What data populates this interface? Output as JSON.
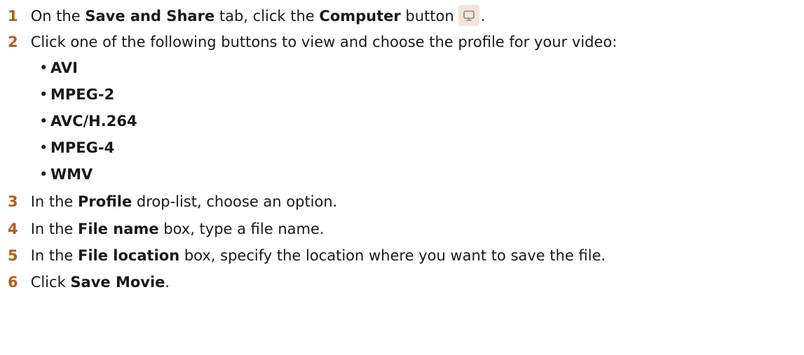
{
  "steps": [
    {
      "num": "1",
      "pre": "On the ",
      "b1": "Save and Share",
      "mid": " tab, click the ",
      "b2": "Computer",
      "post": " button",
      "tail": "."
    },
    {
      "num": "2",
      "text": "Click one of the following buttons to view and choose the profile for your video:"
    },
    {
      "num": "3",
      "pre": "In the ",
      "bold": "Profile",
      "post": " drop-list, choose an option."
    },
    {
      "num": "4",
      "pre": "In the ",
      "bold": "File name",
      "post": " box, type a file name."
    },
    {
      "num": "5",
      "pre": "In the ",
      "bold": "File location",
      "post": " box, specify the location where you want to save the file."
    },
    {
      "num": "6",
      "pre": "Click ",
      "bold": "Save Movie",
      "post": "."
    }
  ],
  "bullet": "•",
  "formats": [
    "AVI",
    "MPEG-2",
    "AVC/H.264",
    "MPEG-4",
    "WMV"
  ],
  "icons": {
    "computer": "computer-icon"
  }
}
